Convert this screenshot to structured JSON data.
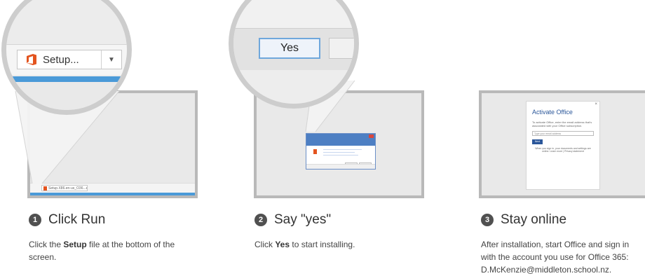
{
  "steps": [
    {
      "number": "1",
      "title": "Click Run",
      "desc_before": "Click the ",
      "desc_bold": "Setup",
      "desc_after": " file at the bottom of the screen.",
      "magnified_button_label": "Setup...",
      "tiny_download_label": "Setup.X86.en-us_O36...exe"
    },
    {
      "number": "2",
      "title": "Say \"yes\"",
      "desc_before": "Click ",
      "desc_bold": "Yes",
      "desc_after": " to start installing.",
      "magnified_button_label": "Yes"
    },
    {
      "number": "3",
      "title": "Stay online",
      "desc_line1": "After installation, start Office and sign in",
      "desc_line2": "with the account you use for Office 365:",
      "desc_line3": "D.McKenzie@middleton.school.nz.",
      "card_title": "Activate Office",
      "card_text": "To activate Office, enter the email address that's associated with your Office subscription.",
      "card_input_placeholder": "Type your email address",
      "card_button": "Next",
      "card_small": "When you sign in, your documents and settings are online. Learn more | Privacy statement"
    }
  ],
  "colors": {
    "accent_blue": "#4a9ad8",
    "office_orange": "#e3541f",
    "office_blue": "#2b579a",
    "badge": "#505050"
  }
}
